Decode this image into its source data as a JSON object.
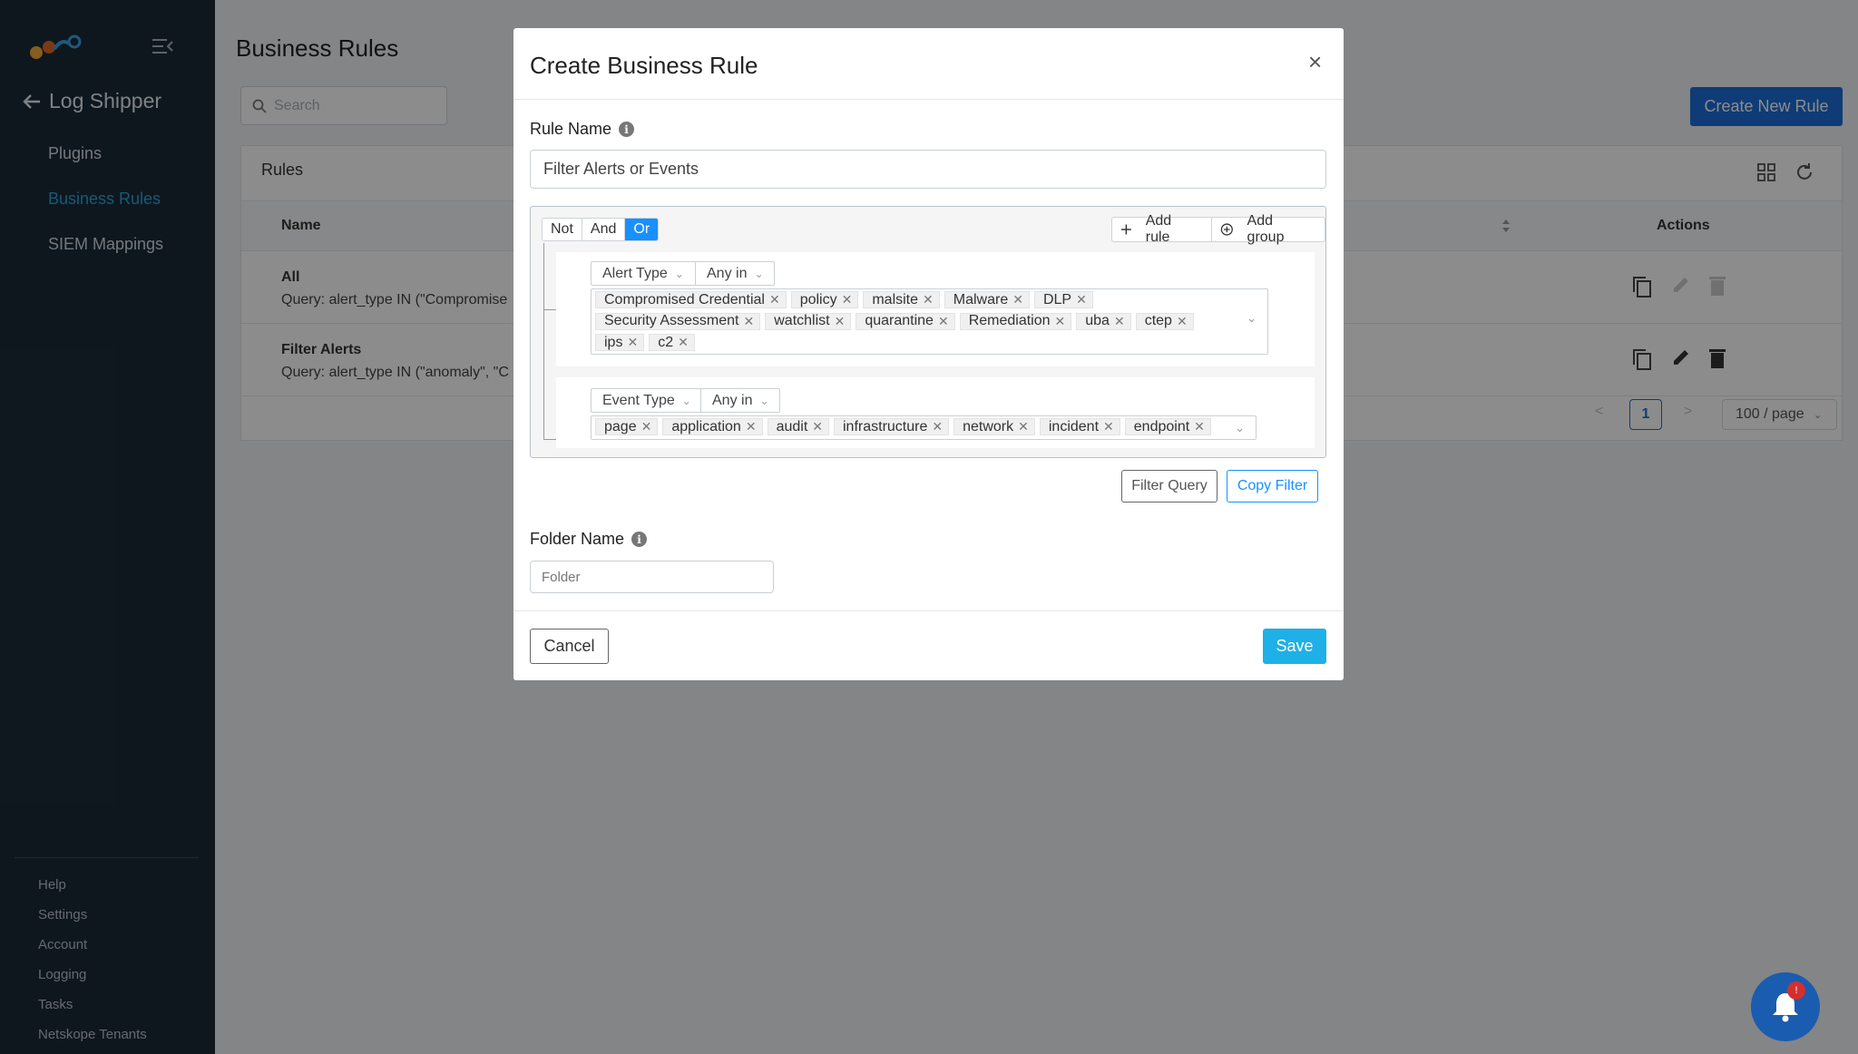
{
  "sidebar": {
    "back_label": "Log Shipper",
    "items": [
      {
        "label": "Plugins",
        "active": false
      },
      {
        "label": "Business Rules",
        "active": true
      },
      {
        "label": "SIEM Mappings",
        "active": false
      }
    ],
    "footer": [
      "Help",
      "Settings",
      "Account",
      "Logging",
      "Tasks",
      "Netskope Tenants"
    ]
  },
  "page": {
    "title": "Business Rules",
    "search_placeholder": "Search",
    "create_button": "Create New Rule"
  },
  "rules_card": {
    "title": "Rules",
    "columns": {
      "name": "Name",
      "actions": "Actions"
    },
    "rows": [
      {
        "name": "All",
        "query": "Query: alert_type IN (\"Compromise"
      },
      {
        "name": "Filter Alerts",
        "query": "Query: alert_type IN (\"anomaly\", \"C"
      }
    ],
    "pagination": {
      "current": "1",
      "page_size": "100 / page"
    }
  },
  "modal": {
    "title": "Create Business Rule",
    "close": "×",
    "rule_name_label": "Rule Name",
    "rule_name_value": "Filter Alerts or Events",
    "conjunctions": [
      "Not",
      "And",
      "Or"
    ],
    "active_conjunction": "Or",
    "add_rule": "Add rule",
    "add_group": "Add group",
    "rule1": {
      "field": "Alert Type",
      "operator": "Any in",
      "values": [
        "Compromised Credential",
        "policy",
        "malsite",
        "Malware",
        "DLP",
        "Security Assessment",
        "watchlist",
        "quarantine",
        "Remediation",
        "uba",
        "ctep",
        "ips",
        "c2"
      ]
    },
    "rule2": {
      "field": "Event Type",
      "operator": "Any in",
      "values": [
        "page",
        "application",
        "audit",
        "infrastructure",
        "network",
        "incident",
        "endpoint"
      ]
    },
    "filter_query_button": "Filter Query",
    "copy_filter_button": "Copy Filter",
    "folder_label": "Folder Name",
    "folder_placeholder": "Folder",
    "cancel_button": "Cancel",
    "save_button": "Save"
  },
  "notification": {
    "badge": "!"
  },
  "colors": {
    "sidebar_bg": "#1b2a38",
    "accent": "#1c6ed8",
    "active_nav": "#2aa4d8",
    "save": "#1eb0e6",
    "conj_active": "#1890ff"
  }
}
